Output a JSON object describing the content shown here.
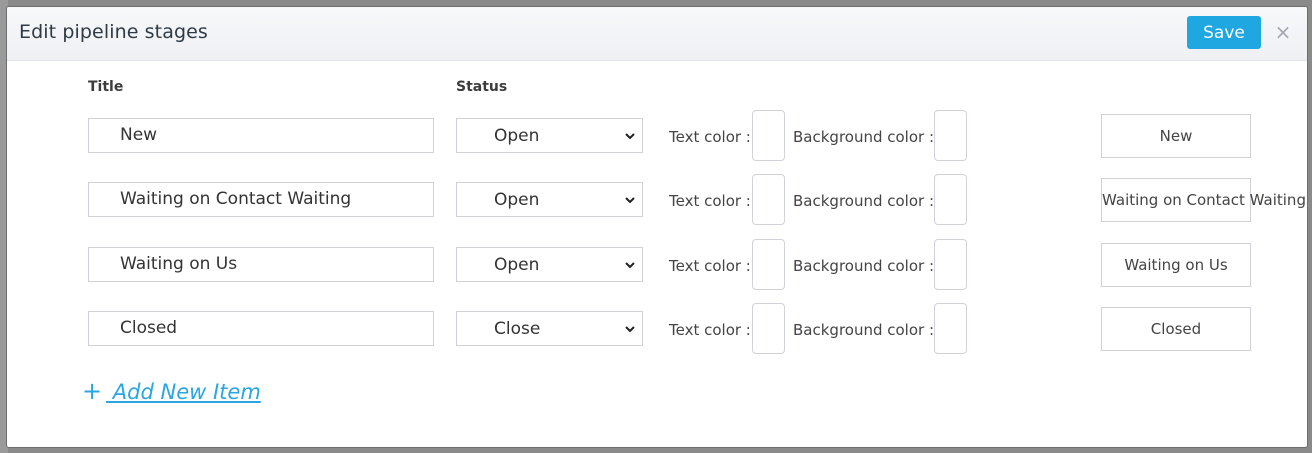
{
  "modal": {
    "title": "Edit pipeline stages",
    "save_label": "Save",
    "close_glyph": "×"
  },
  "columns": {
    "title": "Title",
    "status": "Status"
  },
  "labels": {
    "text_color": "Text color :",
    "background_color": "Background color :"
  },
  "stages": [
    {
      "title": "New",
      "status": "Open",
      "preview": "New"
    },
    {
      "title": "Waiting on Contact Waiting",
      "status": "Open",
      "preview": "Waiting on Contact Waiting"
    },
    {
      "title": "Waiting on Us",
      "status": "Open",
      "preview": "Waiting on Us"
    },
    {
      "title": "Closed",
      "status": "Close",
      "preview": "Closed"
    }
  ],
  "add_item": {
    "plus": "+",
    "label": " Add New Item"
  },
  "colors": {
    "accent": "#1ea7e0",
    "link": "#2aa6e3"
  },
  "icons": {
    "close": "close-icon",
    "dropdown": "chevron-down-icon",
    "add": "plus-icon"
  }
}
